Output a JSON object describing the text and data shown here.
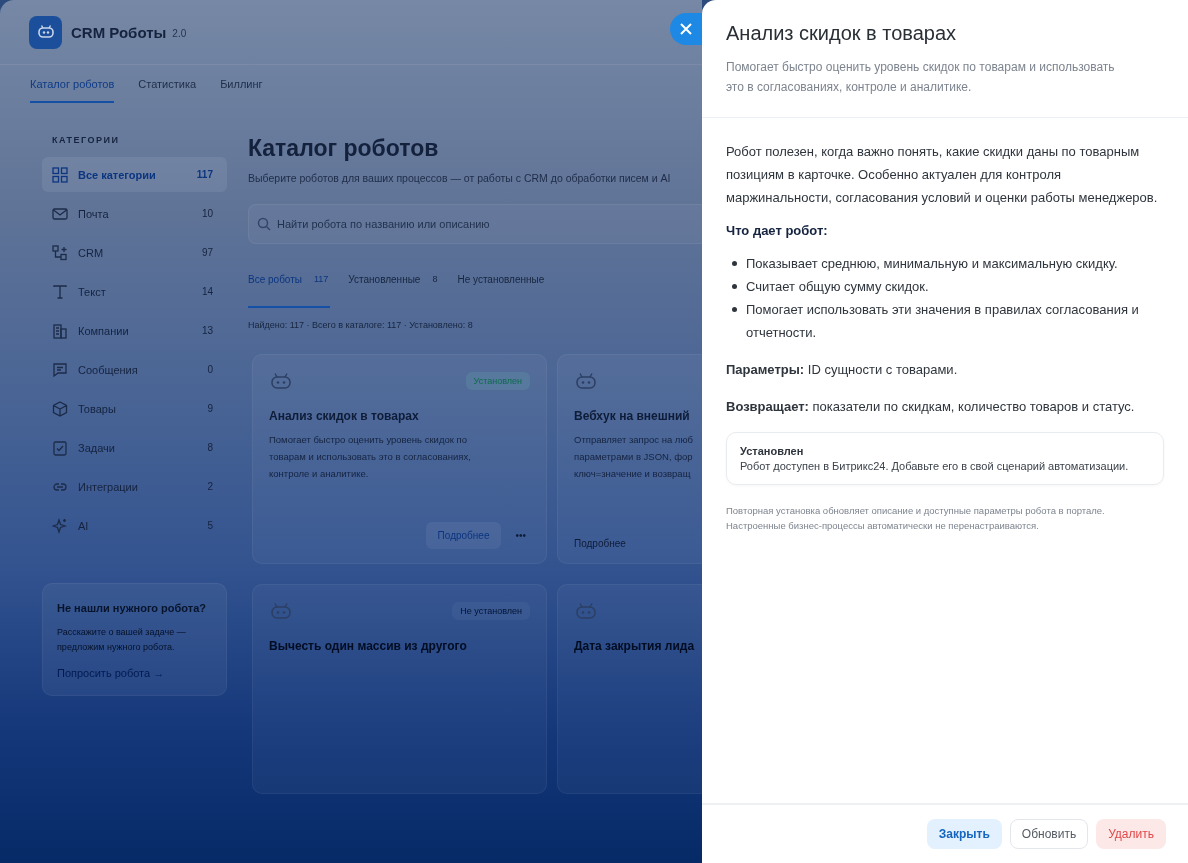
{
  "app": {
    "title": "CRM Роботы",
    "version": "2.0",
    "nav_tabs": [
      {
        "label": "Каталог роботов",
        "selected": true
      },
      {
        "label": "Статистика",
        "selected": false
      },
      {
        "label": "Биллинг",
        "selected": false
      }
    ],
    "sidebar": {
      "heading": "КАТЕГОРИИ",
      "categories": [
        {
          "label": "Все категории",
          "count": "117",
          "selected": true
        },
        {
          "label": "Почта",
          "count": "10",
          "selected": false
        },
        {
          "label": "CRM",
          "count": "97",
          "selected": false
        },
        {
          "label": "Текст",
          "count": "14",
          "selected": false
        },
        {
          "label": "Компании",
          "count": "13",
          "selected": false
        },
        {
          "label": "Сообщения",
          "count": "0",
          "selected": false
        },
        {
          "label": "Товары",
          "count": "9",
          "selected": false
        },
        {
          "label": "Задачи",
          "count": "8",
          "selected": false
        },
        {
          "label": "Интеграции",
          "count": "2",
          "selected": false
        },
        {
          "label": "AI",
          "count": "5",
          "selected": false
        }
      ],
      "help": {
        "title": "Не нашли нужного робота?",
        "text": "Расскажите о вашей задаче — предложим нужного робота.",
        "link": "Попросить робота →"
      }
    },
    "catalog": {
      "title": "Каталог роботов",
      "subtitle": "Выберите роботов для ваших процессов — от работы с CRM до обработки писем и AI",
      "search": {
        "placeholder": "Найти робота по названию или описанию"
      },
      "filter_tabs": [
        {
          "label": "Все роботы",
          "count": "117",
          "selected": true
        },
        {
          "label": "Установленные",
          "count": "8",
          "selected": false
        },
        {
          "label": "Не установленные",
          "selected": false
        }
      ],
      "summary": "Найдено: 117 · Всего в каталоге: 117 · Установлено: 8",
      "cards": [
        {
          "title": "Анализ скидок в товарах",
          "status": "Установлен",
          "installed": true,
          "description_lines": [
            "Помогает быстро оценить уровень скидок по",
            "товарам и использовать это в согласованиях,",
            "контроле и аналитике."
          ],
          "more": "Подробнее",
          "menu": "•••"
        },
        {
          "title": "Вебхук на внешний",
          "description_lines": [
            "Отправляет запрос на люб",
            "параметрами в JSON, фор",
            "ключ=значение и возвращ"
          ],
          "more": "Подробнее"
        },
        {
          "title": "Вычесть один массив из другого",
          "status": "Не установлен",
          "installed": false
        },
        {
          "title": "Дата закрытия лида"
        }
      ]
    }
  },
  "drawer": {
    "title": "Анализ скидок в товарах",
    "subtitle": "Помогает быстро оценить уровень скидок по товарам и использовать это в согласованиях, контроле и аналитике.",
    "intro": "Робот полезен, когда важно понять, какие скидки даны по товарным позициям в карточке. Особенно актуален для контроля маржинальности, согласования условий и оценки работы менеджеров.",
    "section_heading": "Что дает робот:",
    "bullets": [
      "Показывает среднюю, минимальную и максимальную скидку.",
      "Считает общую сумму скидок.",
      "Помогает использовать эти значения в правилах согласования и отчетности."
    ],
    "params": "**Параметры:** ID сущности с товарами.",
    "returns": "**Возвращает:** показатели по скидкам, количество товаров и статус.",
    "status_box": {
      "title": "Установлен",
      "text": "Робот доступен в Битрикс24. Добавьте его в свой сценарий автоматизации."
    },
    "note_lines": [
      "Повторная установка обновляет описание и доступные параметры робота в портале.",
      "Настроенные бизнес-процессы автоматически не перенастраиваются."
    ],
    "buttons": [
      {
        "label": "Закрыть",
        "kind": "primary"
      },
      {
        "label": "Обновить",
        "kind": "secondary"
      },
      {
        "label": "Удалить",
        "kind": "danger"
      }
    ]
  }
}
